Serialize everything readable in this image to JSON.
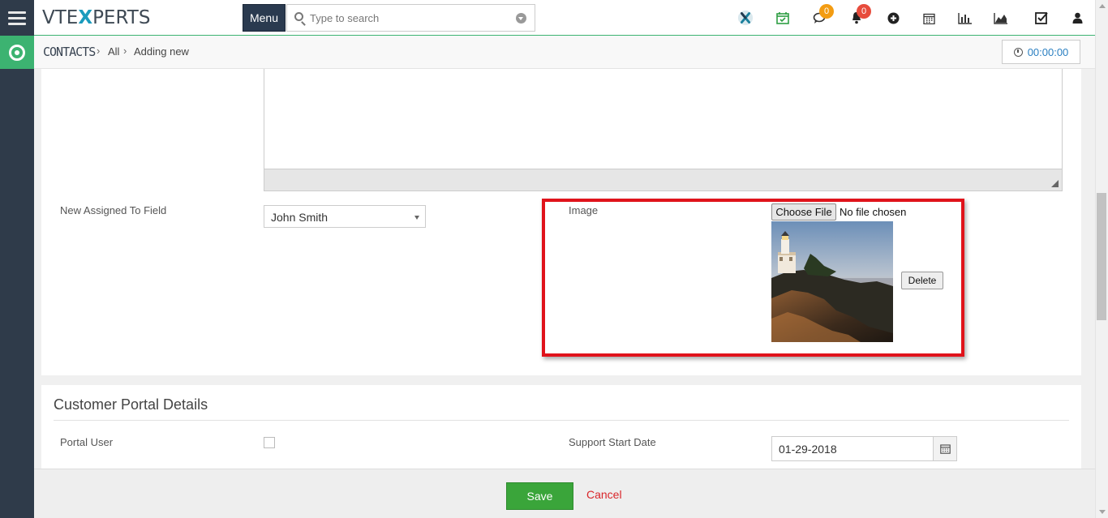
{
  "brand": {
    "logo_pre": "VTE",
    "logo_x": "X",
    "logo_post": "PERTS"
  },
  "header": {
    "menu_label": "Menu",
    "search_placeholder": "Type to search",
    "chat_count": "0",
    "notify_count": "0",
    "icons": [
      "vtexperts-x-icon",
      "calendar-check-icon",
      "chat-icon",
      "bell-icon",
      "plus-circle-icon",
      "calendar-icon",
      "bar-chart-icon",
      "area-chart-icon",
      "checkbox-icon",
      "user-icon"
    ]
  },
  "breadcrumb": {
    "module": "CONTACTS",
    "level1": "All",
    "level2": "Adding new",
    "timer": "00:00:00"
  },
  "form": {
    "assigned_label": "New Assigned To Field",
    "assigned_value": "John Smith",
    "image_label": "Image",
    "choose_file": "Choose File",
    "no_file": "No file chosen",
    "delete_label": "Delete"
  },
  "portal": {
    "section_title": "Customer Portal Details",
    "portal_user_label": "Portal User",
    "portal_user_checked": false,
    "support_start_label": "Support Start Date",
    "support_start_value": "01-29-2018"
  },
  "footer": {
    "save_label": "Save",
    "cancel_label": "Cancel"
  },
  "colors": {
    "accent_green": "#3cb371",
    "rail": "#2f3b4a",
    "highlight_red": "#e0131b",
    "save_green": "#3aa53a",
    "cancel_red": "#d9262a",
    "badge_orange": "#f39c12",
    "badge_red": "#e74c3c"
  }
}
